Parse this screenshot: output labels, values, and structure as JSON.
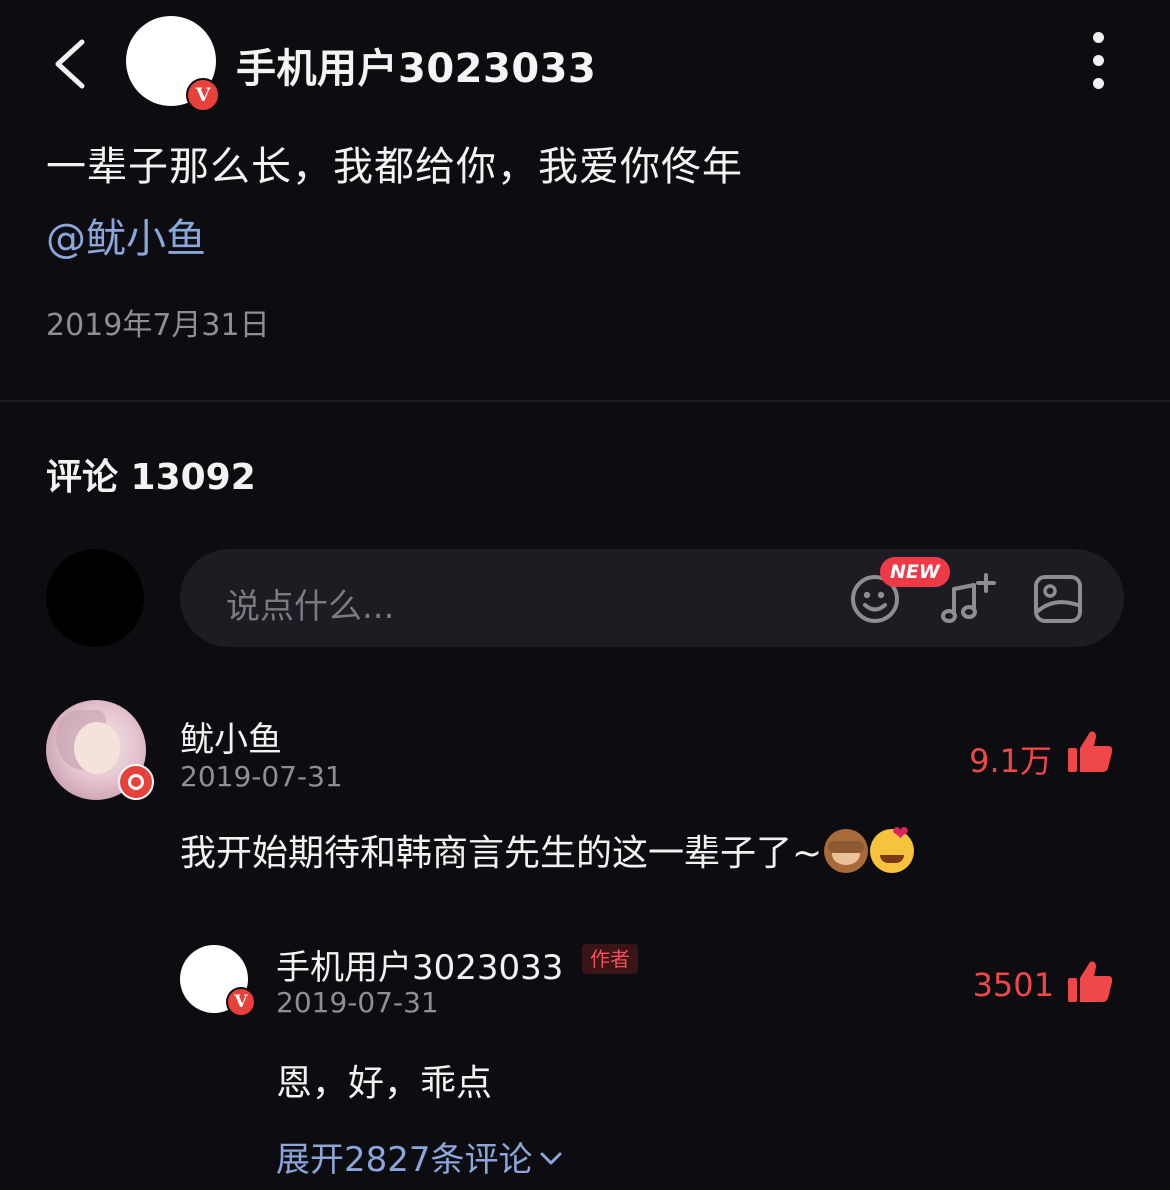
{
  "header": {
    "username": "手机用户3023033",
    "verified_badge": "V"
  },
  "post": {
    "text": "一辈子那么长，我都给你，我爱你佟年",
    "mention": "@鱿小鱼",
    "date": "2019年7月31日"
  },
  "comments_section": {
    "title": "评论 13092",
    "input_placeholder": "说点什么...",
    "new_badge": "NEW"
  },
  "comments": [
    {
      "author": "鱿小鱼",
      "date": "2019-07-31",
      "likes": "9.1万",
      "text": "我开始期待和韩商言先生的这一辈子了~",
      "emojis": [
        "see-no-evil-monkey",
        "smiling-face-with-hearts"
      ],
      "replies": [
        {
          "author": "手机用户3023033",
          "author_tag": "作者",
          "verified_badge": "V",
          "date": "2019-07-31",
          "likes": "3501",
          "text": "恩，好，乖点"
        }
      ],
      "expand_label": "展开2827条评论"
    }
  ],
  "colors": {
    "background": "#0d0c11",
    "accent_red": "#f04848",
    "link_blue": "#8aa6db",
    "muted_text": "#8e8e93"
  },
  "icons": [
    "back-icon",
    "more-icon",
    "emoji-icon",
    "music-icon",
    "image-icon",
    "thumbs-up-icon",
    "chevron-down-icon"
  ]
}
